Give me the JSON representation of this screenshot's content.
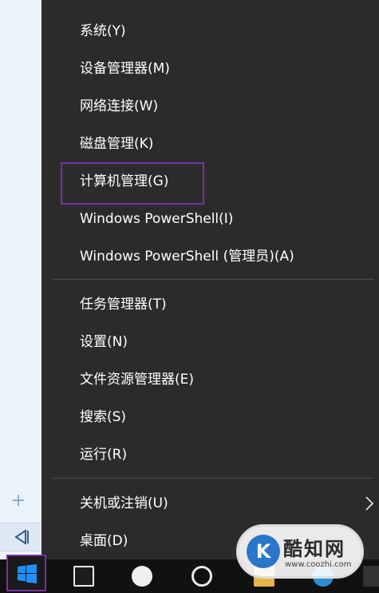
{
  "menu": {
    "items": [
      {
        "label": "系统(Y)"
      },
      {
        "label": "设备管理器(M)"
      },
      {
        "label": "网络连接(W)"
      },
      {
        "label": "磁盘管理(K)"
      },
      {
        "label": "计算机管理(G)"
      },
      {
        "label": "Windows PowerShell(I)"
      },
      {
        "label": "Windows PowerShell (管理员)(A)"
      },
      {
        "label": "任务管理器(T)"
      },
      {
        "label": "设置(N)"
      },
      {
        "label": "文件资源管理器(E)"
      },
      {
        "label": "搜索(S)"
      },
      {
        "label": "运行(R)"
      },
      {
        "label": "关机或注销(U)"
      },
      {
        "label": "桌面(D)"
      }
    ]
  },
  "left_strip": {
    "plus_glyph": "+",
    "collapse_icon": "collapse-left-icon"
  },
  "taskbar": {
    "start_icon": "windows-logo-icon",
    "icons": [
      "task-view-icon",
      "qq-icon",
      "ie-icon",
      "folder-icon",
      "globe-icon"
    ]
  },
  "watermark": {
    "logo_letter": "K",
    "title": "酷知网",
    "url": "www.coozhi.com"
  },
  "colors": {
    "menu_bg": "#2b2b2b",
    "menu_text": "#ffffff",
    "highlight_border": "#7a2fa8",
    "separator": "#4b4b4b",
    "taskbar_bg": "#111111"
  }
}
